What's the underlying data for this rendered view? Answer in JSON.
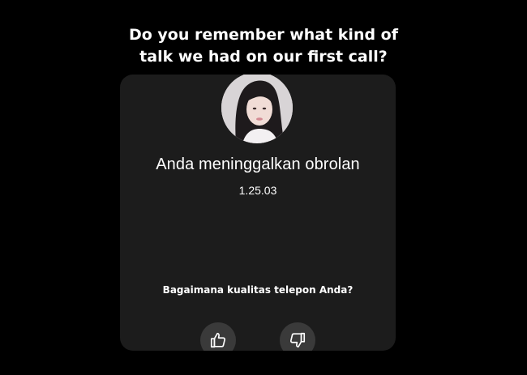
{
  "caption": {
    "line1": "Do you remember what kind of",
    "line2": "talk we had on our first call?"
  },
  "call_card": {
    "status_text": "Anda meninggalkan obrolan",
    "duration": "1.25.03",
    "rating_question": "Bagaimana kualitas telepon Anda?",
    "rating_buttons": [
      {
        "icon": "thumbs-up-icon"
      },
      {
        "icon": "thumbs-down-icon"
      }
    ]
  },
  "colors": {
    "background": "#000000",
    "card": "#1c1c1c",
    "button": "#3a3a3a",
    "text": "#ffffff"
  }
}
